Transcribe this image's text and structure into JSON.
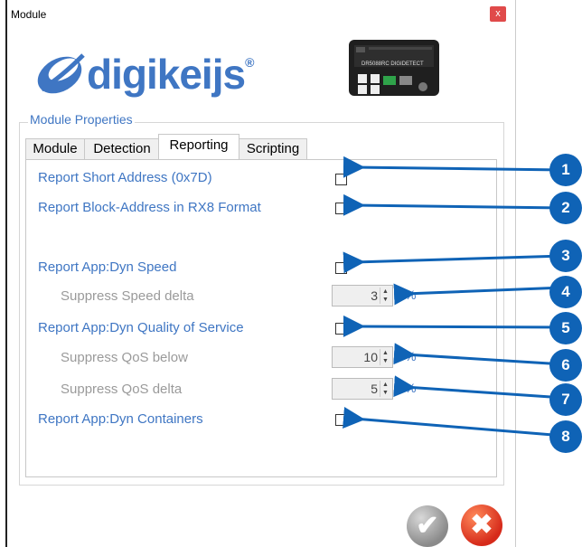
{
  "window": {
    "title": "Module",
    "close_label": "x"
  },
  "brand": {
    "name": "digikeijs",
    "reg": "®"
  },
  "device": {
    "label": "DR5088RC DIGIDETECT"
  },
  "group": {
    "legend": "Module Properties"
  },
  "tabs": [
    {
      "label": "Module",
      "active": false
    },
    {
      "label": "Detection",
      "active": false
    },
    {
      "label": "Reporting",
      "active": true
    },
    {
      "label": "Scripting",
      "active": false
    }
  ],
  "rows": {
    "short_address": {
      "label": "Report Short Address (0x7D)",
      "checked": false
    },
    "block_address": {
      "label": "Report Block-Address in RX8 Format",
      "checked": false
    },
    "dyn_speed": {
      "label": "Report App:Dyn Speed",
      "checked": false
    },
    "speed_delta": {
      "label": "Suppress Speed delta",
      "value": "3",
      "unit": "%"
    },
    "dyn_qos": {
      "label": "Report App:Dyn Quality of Service",
      "checked": false
    },
    "qos_below": {
      "label": "Suppress QoS below",
      "value": "10",
      "unit": "%"
    },
    "qos_delta": {
      "label": "Suppress QoS delta",
      "value": "5",
      "unit": "%"
    },
    "dyn_containers": {
      "label": "Report App:Dyn Containers",
      "checked": false
    }
  },
  "markers": [
    "1",
    "2",
    "3",
    "4",
    "5",
    "6",
    "7",
    "8"
  ],
  "colors": {
    "accent": "#3f76c3",
    "marker": "#0f63b6",
    "muted": "#9a9a9a"
  }
}
